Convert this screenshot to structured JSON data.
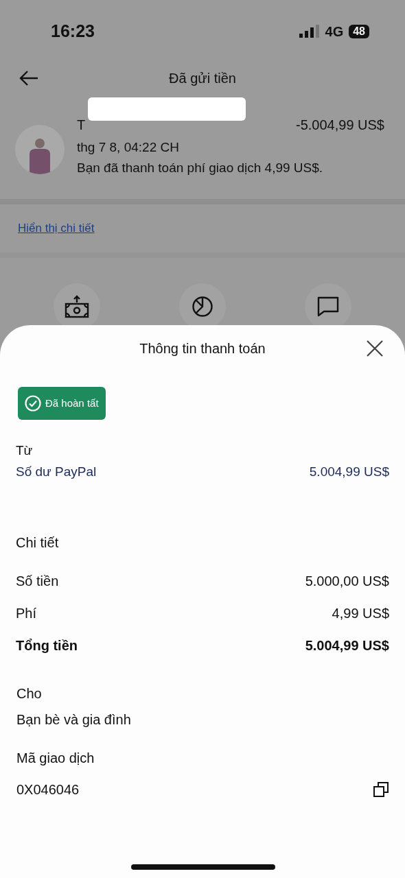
{
  "status_bar": {
    "time": "16:23",
    "network": "4G",
    "battery": "48"
  },
  "header": {
    "title": "Đã gửi tiền"
  },
  "transaction": {
    "name": "T",
    "amount": "-5.004,99 US$",
    "date": "thg 7 8, 04:22 CH",
    "note": "Bạn đã thanh toán phí giao dịch 4,99 US$."
  },
  "details_link": "Hiển thị chi tiết",
  "actions": [
    {
      "kind": "money"
    },
    {
      "kind": "pie"
    },
    {
      "kind": "chat"
    }
  ],
  "sheet": {
    "title": "Thông tin thanh toán",
    "status": "Đã hoàn tất",
    "from": {
      "label": "Từ",
      "source": "Số dư PayPal",
      "amount": "5.004,99 US$"
    },
    "details": {
      "heading": "Chi tiết",
      "rows": [
        {
          "label": "Số tiền",
          "value": "5.000,00 US$",
          "kind": "normal"
        },
        {
          "label": "Phí",
          "value": "4,99 US$",
          "kind": "normal"
        },
        {
          "label": "Tổng tiền",
          "value": "5.004,99 US$",
          "kind": "total"
        }
      ]
    },
    "to": {
      "label": "Cho",
      "value": "Bạn bè và gia đình"
    },
    "transaction_id": {
      "label": "Mã giao dịch",
      "value": "0X046046"
    }
  }
}
